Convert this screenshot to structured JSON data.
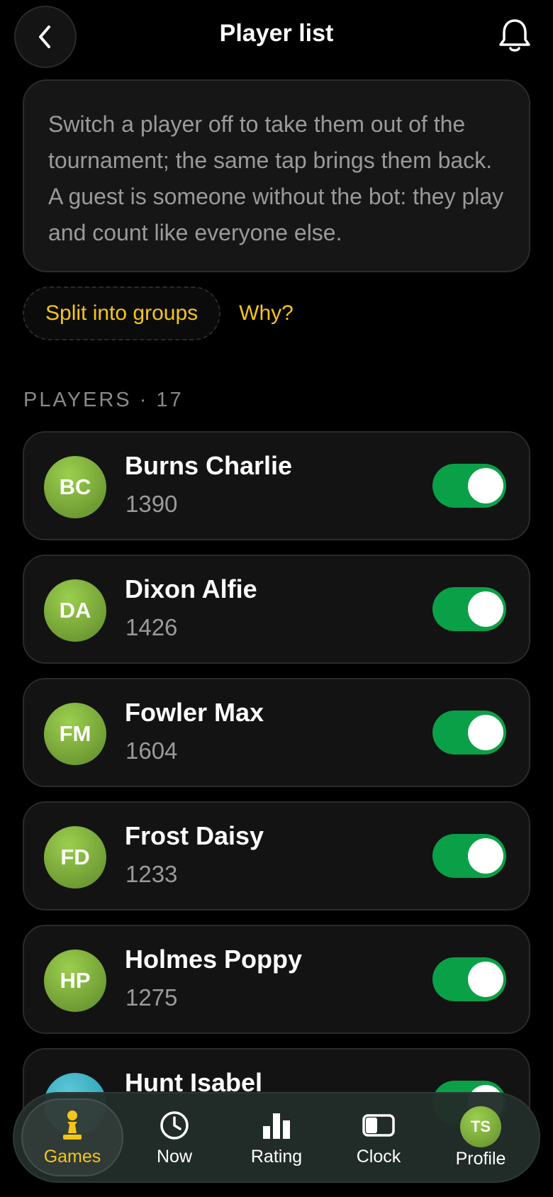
{
  "header": {
    "title": "Player list"
  },
  "info": {
    "text": "Switch a player off to take them out of the tournament; the same tap brings them back. A guest is someone without the bot: they play and count like everyone else."
  },
  "actions": {
    "split_label": "Split into groups",
    "why_label": "Why?"
  },
  "section": {
    "label": "PLAYERS · 17"
  },
  "players": [
    {
      "initials": "BC",
      "name": "Burns Charlie",
      "rating": "1390",
      "active": true
    },
    {
      "initials": "DA",
      "name": "Dixon Alfie",
      "rating": "1426",
      "active": true
    },
    {
      "initials": "FM",
      "name": "Fowler Max",
      "rating": "1604",
      "active": true
    },
    {
      "initials": "FD",
      "name": "Frost Daisy",
      "rating": "1233",
      "active": true
    },
    {
      "initials": "HP",
      "name": "Holmes Poppy",
      "rating": "1275",
      "active": true
    },
    {
      "initials": "",
      "name": "Hunt Isabel",
      "rating": "",
      "active": true
    }
  ],
  "nav": {
    "items": [
      {
        "label": "Games",
        "icon": "pawn-icon",
        "active": true
      },
      {
        "label": "Now",
        "icon": "clock-icon",
        "active": false
      },
      {
        "label": "Rating",
        "icon": "bar-chart-icon",
        "active": false
      },
      {
        "label": "Clock",
        "icon": "chess-clock-icon",
        "active": false
      },
      {
        "label": "Profile",
        "icon": "avatar",
        "active": false
      }
    ],
    "profile_initials": "TS"
  },
  "colors": {
    "accent": "#f5c518",
    "toggle_on": "#0aa048",
    "background": "#000000",
    "card": "#131313"
  }
}
